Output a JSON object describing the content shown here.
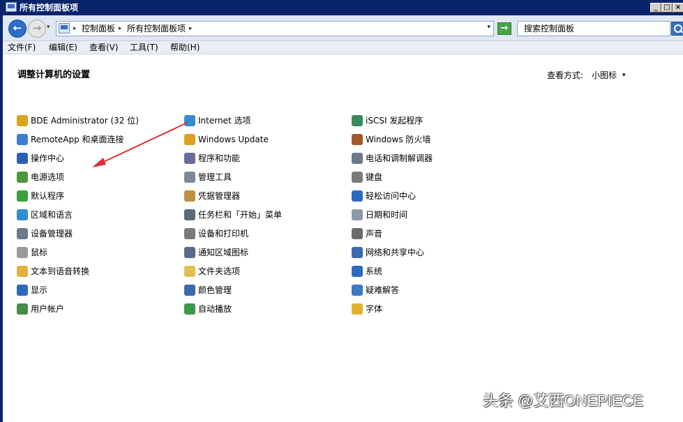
{
  "window": {
    "title": "所有控制面板项"
  },
  "titlebar_buttons": {
    "minimize": "_",
    "maximize": "□",
    "close": "×"
  },
  "nav": {
    "back_glyph": "←",
    "forward_glyph": "→",
    "dropdown_glyph": "▾"
  },
  "address": {
    "crumbs": [
      "控制面板",
      "所有控制面板项"
    ],
    "separator_glyph": "▸",
    "dropdown_glyph": "▾"
  },
  "refresh_glyph": "→",
  "search": {
    "placeholder": "搜索控制面板"
  },
  "menu": [
    "文件(F)",
    "编辑(E)",
    "查看(V)",
    "工具(T)",
    "帮助(H)"
  ],
  "heading": "调整计算机的设置",
  "view_by": {
    "label": "查看方式:",
    "value": "小图标",
    "arrow": "▾"
  },
  "columns": [
    [
      {
        "label": "BDE Administrator (32 位)",
        "icon": "bde-admin-icon",
        "color": "#d9a520"
      },
      {
        "label": "RemoteApp 和桌面连接",
        "icon": "remoteapp-icon",
        "color": "#3a7fd0"
      },
      {
        "label": "操作中心",
        "icon": "action-center-flag-icon",
        "color": "#2a5fb8"
      },
      {
        "label": "电源选项",
        "icon": "power-options-icon",
        "color": "#4a9a3a"
      },
      {
        "label": "默认程序",
        "icon": "default-programs-icon",
        "color": "#3aa03a"
      },
      {
        "label": "区域和语言",
        "icon": "region-language-icon",
        "color": "#2f8fd0"
      },
      {
        "label": "设备管理器",
        "icon": "device-manager-icon",
        "color": "#6a7a8a"
      },
      {
        "label": "鼠标",
        "icon": "mouse-icon",
        "color": "#9a9a9a"
      },
      {
        "label": "文本到语音转换",
        "icon": "text-to-speech-icon",
        "color": "#e0b040"
      },
      {
        "label": "显示",
        "icon": "display-icon",
        "color": "#2a6ac0"
      },
      {
        "label": "用户帐户",
        "icon": "user-accounts-icon",
        "color": "#4a8a4a"
      }
    ],
    [
      {
        "label": "Internet 选项",
        "icon": "internet-options-icon",
        "color": "#3a8ad0"
      },
      {
        "label": "Windows Update",
        "icon": "windows-update-icon",
        "color": "#e0a020"
      },
      {
        "label": "程序和功能",
        "icon": "programs-features-icon",
        "color": "#6a6aa0"
      },
      {
        "label": "管理工具",
        "icon": "admin-tools-icon",
        "color": "#7a8a9a"
      },
      {
        "label": "凭据管理器",
        "icon": "credential-manager-icon",
        "color": "#c09040"
      },
      {
        "label": "任务栏和「开始」菜单",
        "icon": "taskbar-start-icon",
        "color": "#5a6a7a"
      },
      {
        "label": "设备和打印机",
        "icon": "devices-printers-icon",
        "color": "#7a7a7a"
      },
      {
        "label": "通知区域图标",
        "icon": "notification-area-icon",
        "color": "#5a6a8a"
      },
      {
        "label": "文件夹选项",
        "icon": "folder-options-icon",
        "color": "#e0c050"
      },
      {
        "label": "颜色管理",
        "icon": "color-management-icon",
        "color": "#3a6ab0"
      },
      {
        "label": "自动播放",
        "icon": "autoplay-icon",
        "color": "#3a9a4a"
      }
    ],
    [
      {
        "label": "iSCSI 发起程序",
        "icon": "iscsi-initiator-icon",
        "color": "#3a8a5a"
      },
      {
        "label": "Windows 防火墙",
        "icon": "windows-firewall-icon",
        "color": "#a05a2a"
      },
      {
        "label": "电话和调制解调器",
        "icon": "phone-modem-icon",
        "color": "#6a7a8a"
      },
      {
        "label": "键盘",
        "icon": "keyboard-icon",
        "color": "#7a7a7a"
      },
      {
        "label": "轻松访问中心",
        "icon": "ease-of-access-icon",
        "color": "#2a6ac0"
      },
      {
        "label": "日期和时间",
        "icon": "date-time-icon",
        "color": "#8a9aaa"
      },
      {
        "label": "声音",
        "icon": "sound-icon",
        "color": "#6a6a6a"
      },
      {
        "label": "网络和共享中心",
        "icon": "network-sharing-icon",
        "color": "#3a6ab0"
      },
      {
        "label": "系统",
        "icon": "system-icon",
        "color": "#2a6ac0"
      },
      {
        "label": "疑难解答",
        "icon": "troubleshooting-icon",
        "color": "#3a7ac0"
      },
      {
        "label": "字体",
        "icon": "fonts-icon",
        "color": "#e0b030"
      }
    ]
  ],
  "annotation_color": "#e03030",
  "watermark": "头条 @艾西ONEPIECE"
}
